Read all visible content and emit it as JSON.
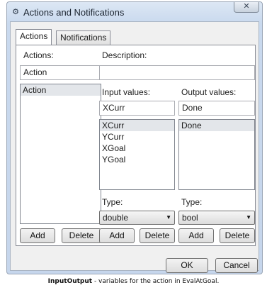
{
  "window": {
    "title": "Actions and Notifications",
    "close_glyph": "✕",
    "icon": "gear-icon"
  },
  "tabs": [
    {
      "label": "Actions",
      "active": true
    },
    {
      "label": "Notifications",
      "active": false
    }
  ],
  "actions": {
    "actions_label": "Actions:",
    "description_label": "Description:",
    "action_name_value": "Action",
    "description_value": "",
    "action_list": [
      "Action"
    ],
    "input_label": "Input values:",
    "output_label": "Output values:",
    "input_field_value": "XCurr",
    "output_field_value": "Done",
    "input_list": [
      "XCurr",
      "YCurr",
      "XGoal",
      "YGoal"
    ],
    "output_list": [
      "Done"
    ],
    "input_type_label": "Type:",
    "output_type_label": "Type:",
    "input_type_value": "double",
    "output_type_value": "bool",
    "add_label": "Add",
    "delete_label": "Delete"
  },
  "dialog": {
    "ok_label": "OK",
    "cancel_label": "Cancel"
  },
  "caption": {
    "bold": "InputOutput",
    "text": " - variables for the action in EvalAtGoal."
  }
}
